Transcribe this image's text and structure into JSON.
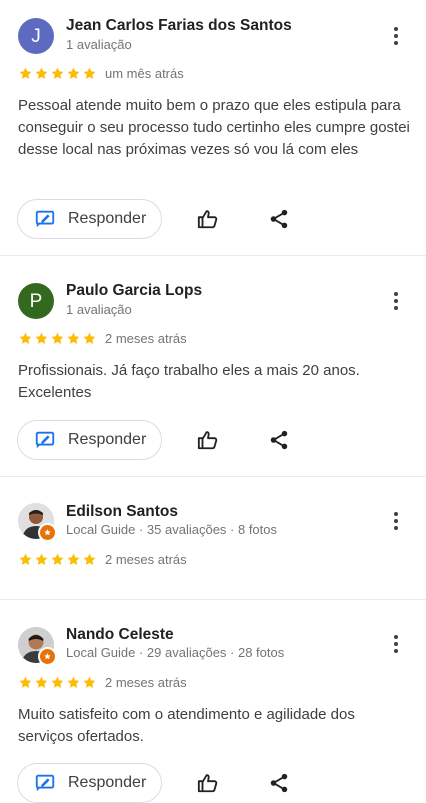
{
  "colors": {
    "star": "#fbbc04",
    "divider": "#e8eaed",
    "reply_icon": "#1a73e8",
    "badge": "#e8710a"
  },
  "reviews": [
    {
      "name": "Jean Carlos Farias dos Santos",
      "avatar_letter": "J",
      "avatar_color": "#5c6bc0",
      "meta": "1 avaliação",
      "time": "um mês atrás",
      "text": "Pessoal atende muito bem o prazo que eles estipula para conseguir o seu processo tudo certinho eles cumpre gostei desse local nas próximas vezes só vou lá com eles",
      "reply_label": "Responder"
    },
    {
      "name": "Paulo Garcia Lops",
      "avatar_letter": "P",
      "avatar_color": "#33691e",
      "meta": "1 avaliação",
      "time": "2 meses atrás",
      "text": "Profissionais. Já faço trabalho eles a mais 20 anos. Excelentes",
      "reply_label": "Responder"
    },
    {
      "name": "Edilson Santos",
      "avatar_icon": "user-photo-icon",
      "meta": "Local Guide · 35 avaliações · 8 fotos",
      "time": "2 meses atrás"
    },
    {
      "name": "Nando Celeste",
      "avatar_icon": "user-photo-icon",
      "meta": "Local Guide · 29 avaliações · 28 fotos",
      "time": "2 meses atrás",
      "text": "Muito satisfeito com o atendimento e agilidade dos serviços ofertados.",
      "reply_label": "Responder"
    }
  ]
}
